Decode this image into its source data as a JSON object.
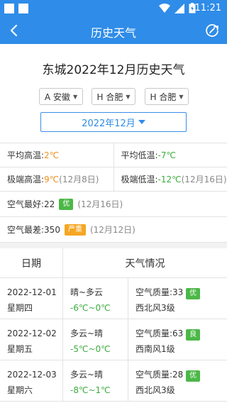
{
  "status": {
    "time": "11:21"
  },
  "appbar": {
    "title": "历史天气"
  },
  "heading": "东城2022年12月历史天气",
  "selects": {
    "province": "A 安徽",
    "city": "H 合肥",
    "district": "H 合肥"
  },
  "month": "2022年12月",
  "stats": {
    "avg_high_label": "平均高温:",
    "avg_high": "2℃",
    "avg_low_label": "平均低温:",
    "avg_low": "-7℃",
    "ext_high_label": "极端高温:",
    "ext_high": "9℃",
    "ext_high_date": "(12月8日)",
    "ext_low_label": "极端低温:",
    "ext_low": "-12℃",
    "ext_low_date": "(12月16日)",
    "best_air_label": "空气最好:22",
    "best_air_badge": "优",
    "best_air_date": "(12月16日)",
    "worst_air_label": "空气最差:350",
    "worst_air_badge": "严重",
    "worst_air_date": "(12月12日)"
  },
  "table": {
    "col_date": "日期",
    "col_weather": "天气情况",
    "rows": [
      {
        "date": "2022-12-01",
        "weekday": "星期四",
        "weather": "晴~多云",
        "temp": "-6℃~0℃",
        "aqi": "空气质量:33",
        "aqi_badge": "优",
        "wind": "西北风3级"
      },
      {
        "date": "2022-12-02",
        "weekday": "星期五",
        "weather": "多云~晴",
        "temp": "-5℃~0℃",
        "aqi": "空气质量:63",
        "aqi_badge": "良",
        "wind": "西南风1级"
      },
      {
        "date": "2022-12-03",
        "weekday": "星期六",
        "weather": "多云~晴",
        "temp": "-8℃~1℃",
        "aqi": "空气质量:28",
        "aqi_badge": "优",
        "wind": "西北风3级"
      }
    ]
  },
  "colors": {
    "primary": "#2f8ce8",
    "cold": "#3cab3c",
    "warm": "#f0901e",
    "badge_good": "#4cb848",
    "badge_severe": "#f5a623"
  }
}
